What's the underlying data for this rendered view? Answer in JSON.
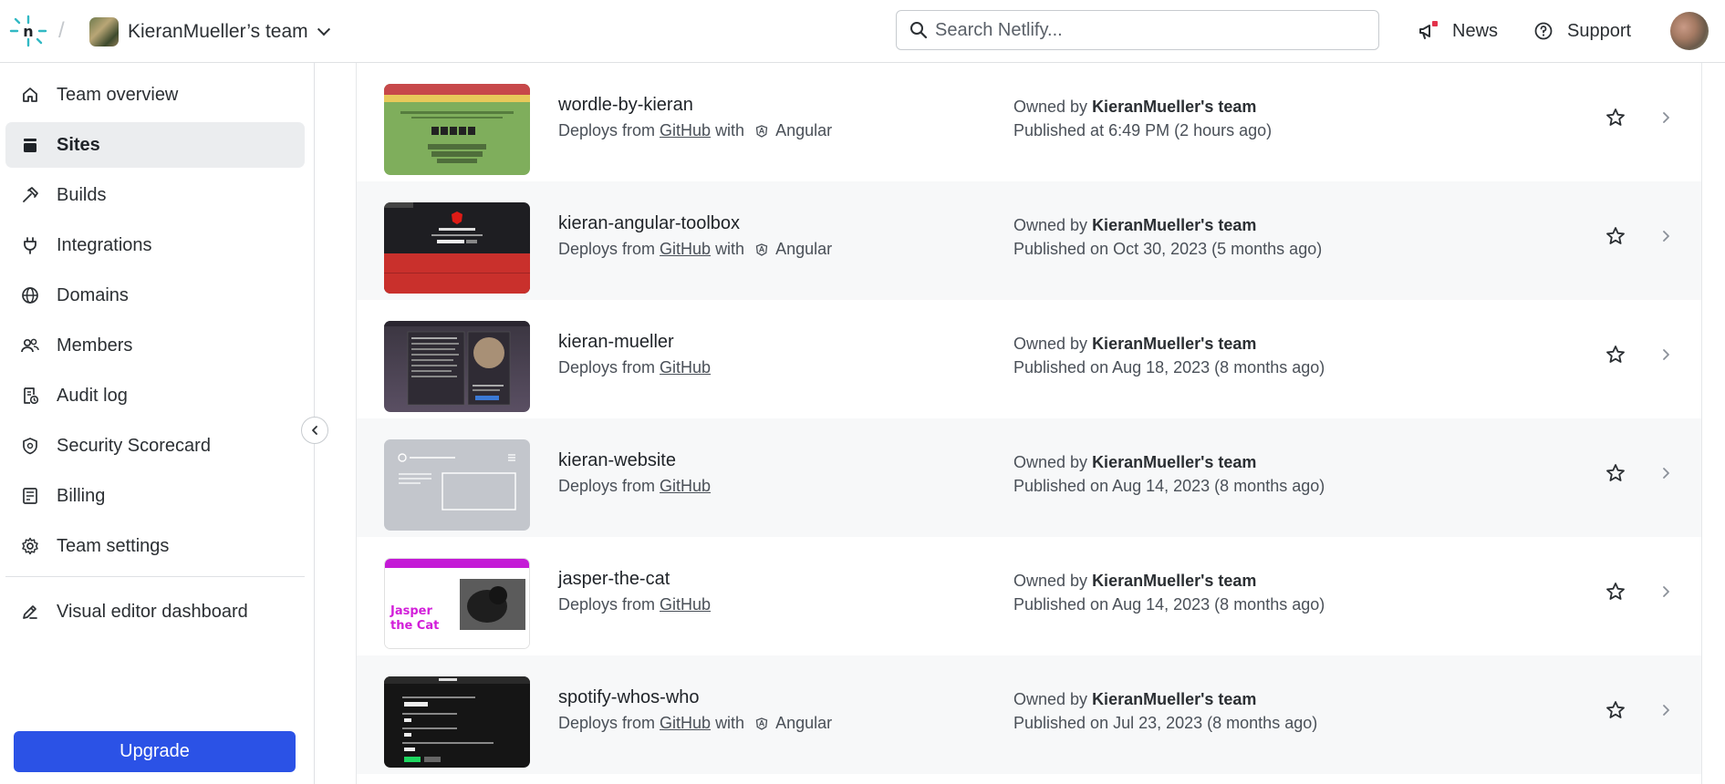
{
  "header": {
    "team_name": "KieranMueller’s team",
    "search_placeholder": "Search Netlify...",
    "news_label": "News",
    "support_label": "Support"
  },
  "sidebar": {
    "items": [
      {
        "label": "Team overview",
        "icon": "home-icon",
        "active": false
      },
      {
        "label": "Sites",
        "icon": "sites-icon",
        "active": true
      },
      {
        "label": "Builds",
        "icon": "hammer-icon",
        "active": false
      },
      {
        "label": "Integrations",
        "icon": "plug-icon",
        "active": false
      },
      {
        "label": "Domains",
        "icon": "globe-icon",
        "active": false
      },
      {
        "label": "Members",
        "icon": "members-icon",
        "active": false
      },
      {
        "label": "Audit log",
        "icon": "audit-log-icon",
        "active": false
      },
      {
        "label": "Security Scorecard",
        "icon": "shield-icon",
        "active": false
      },
      {
        "label": "Billing",
        "icon": "billing-icon",
        "active": false
      },
      {
        "label": "Team settings",
        "icon": "gear-icon",
        "active": false
      }
    ],
    "visual_editor_label": "Visual editor dashboard",
    "upgrade_label": "Upgrade"
  },
  "sites": [
    {
      "name": "wordle-by-kieran",
      "deploys_from": "Deploys from",
      "provider": "GitHub",
      "with": "with",
      "framework": "Angular",
      "owned_prefix": "Owned by",
      "owner": "KieranMueller's team",
      "published": "Published at 6:49 PM (2 hours ago)"
    },
    {
      "name": "kieran-angular-toolbox",
      "deploys_from": "Deploys from",
      "provider": "GitHub",
      "with": "with",
      "framework": "Angular",
      "owned_prefix": "Owned by",
      "owner": "KieranMueller's team",
      "published": "Published on Oct 30, 2023 (5 months ago)"
    },
    {
      "name": "kieran-mueller",
      "deploys_from": "Deploys from",
      "provider": "GitHub",
      "with": "",
      "framework": "",
      "owned_prefix": "Owned by",
      "owner": "KieranMueller's team",
      "published": "Published on Aug 18, 2023 (8 months ago)"
    },
    {
      "name": "kieran-website",
      "deploys_from": "Deploys from",
      "provider": "GitHub",
      "with": "",
      "framework": "",
      "owned_prefix": "Owned by",
      "owner": "KieranMueller's team",
      "published": "Published on Aug 14, 2023 (8 months ago)"
    },
    {
      "name": "jasper-the-cat",
      "deploys_from": "Deploys from",
      "provider": "GitHub",
      "with": "",
      "framework": "",
      "owned_prefix": "Owned by",
      "owner": "KieranMueller's team",
      "published": "Published on Aug 14, 2023 (8 months ago)"
    },
    {
      "name": "spotify-whos-who",
      "deploys_from": "Deploys from",
      "provider": "GitHub",
      "with": "with",
      "framework": "Angular",
      "owned_prefix": "Owned by",
      "owner": "KieranMueller's team",
      "published": "Published on Jul 23, 2023 (8 months ago)"
    }
  ],
  "thumbnails": {
    "jasper_title": "Jasper the Cat",
    "wordle_title": "Wordle by Kieran",
    "spotify_title": "WhosWho"
  },
  "colors": {
    "accent": "#2b52e6",
    "logo": "#32b9c4",
    "news_badge": "#e3324b"
  }
}
